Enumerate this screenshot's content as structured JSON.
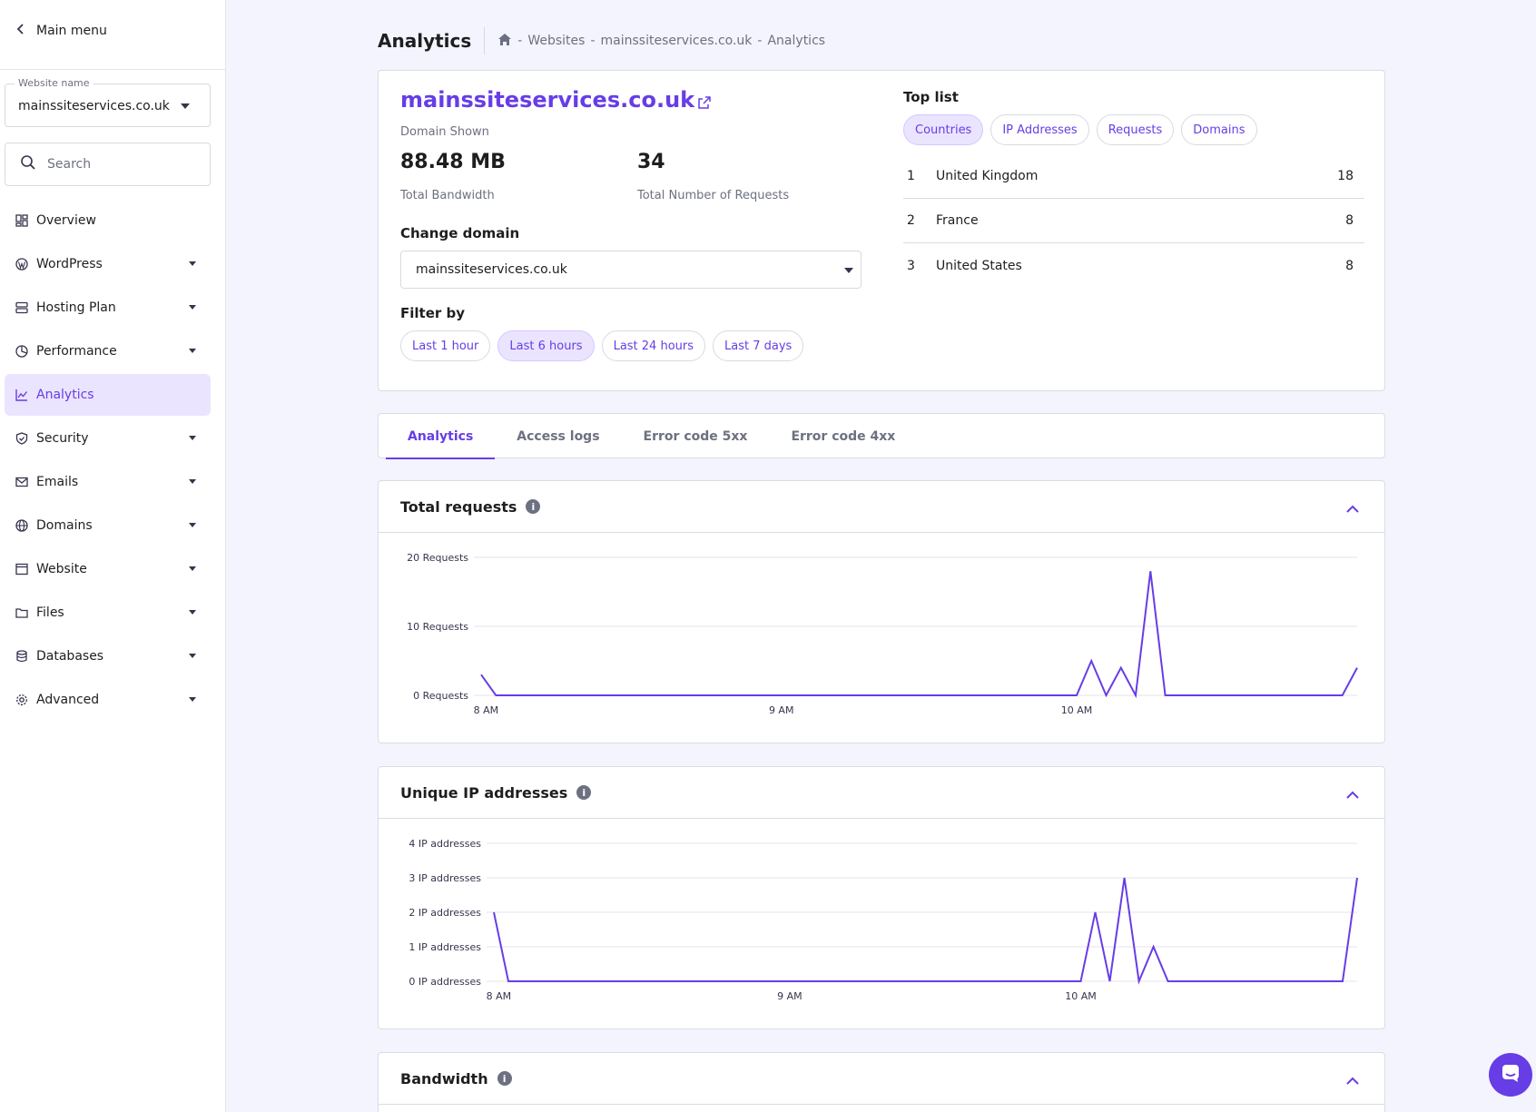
{
  "sidebar": {
    "main_menu_label": "Main menu",
    "website_select": {
      "legend": "Website name",
      "value": "mainssiteservices.co.uk"
    },
    "search_placeholder": "Search",
    "items": [
      {
        "label": "Overview",
        "icon": "grid-icon",
        "has_caret": false,
        "active": false
      },
      {
        "label": "WordPress",
        "icon": "wordpress-icon",
        "has_caret": true,
        "active": false
      },
      {
        "label": "Hosting Plan",
        "icon": "server-icon",
        "has_caret": true,
        "active": false
      },
      {
        "label": "Performance",
        "icon": "pie-chart-icon",
        "has_caret": true,
        "active": false
      },
      {
        "label": "Analytics",
        "icon": "analytics-icon",
        "has_caret": false,
        "active": true
      },
      {
        "label": "Security",
        "icon": "shield-icon",
        "has_caret": true,
        "active": false
      },
      {
        "label": "Emails",
        "icon": "mail-icon",
        "has_caret": true,
        "active": false
      },
      {
        "label": "Domains",
        "icon": "globe-icon",
        "has_caret": true,
        "active": false
      },
      {
        "label": "Website",
        "icon": "browser-icon",
        "has_caret": true,
        "active": false
      },
      {
        "label": "Files",
        "icon": "folder-icon",
        "has_caret": true,
        "active": false
      },
      {
        "label": "Databases",
        "icon": "database-icon",
        "has_caret": true,
        "active": false
      },
      {
        "label": "Advanced",
        "icon": "gear-icon",
        "has_caret": true,
        "active": false
      }
    ]
  },
  "header": {
    "title": "Analytics",
    "breadcrumb": [
      "-",
      "Websites",
      "-",
      "mainssiteservices.co.uk",
      "-",
      "Analytics"
    ]
  },
  "summary": {
    "domain": "mainssiteservices.co.uk",
    "domain_caption": "Domain Shown",
    "bandwidth_value": "88.48 MB",
    "bandwidth_label": "Total Bandwidth",
    "requests_value": "34",
    "requests_label": "Total Number of Requests",
    "change_domain_label": "Change domain",
    "change_domain_value": "mainssiteservices.co.uk",
    "filter_label": "Filter by",
    "filters": [
      {
        "label": "Last 1 hour",
        "selected": false
      },
      {
        "label": "Last 6 hours",
        "selected": true
      },
      {
        "label": "Last 24 hours",
        "selected": false
      },
      {
        "label": "Last 7 days",
        "selected": false
      }
    ]
  },
  "top_list": {
    "title": "Top list",
    "tabs": [
      {
        "label": "Countries",
        "selected": true
      },
      {
        "label": "IP Addresses",
        "selected": false
      },
      {
        "label": "Requests",
        "selected": false
      },
      {
        "label": "Domains",
        "selected": false
      }
    ],
    "rows": [
      {
        "rank": "1",
        "name": "United Kingdom",
        "count": "18"
      },
      {
        "rank": "2",
        "name": "France",
        "count": "8"
      },
      {
        "rank": "3",
        "name": "United States",
        "count": "8"
      }
    ]
  },
  "tabs": [
    {
      "label": "Analytics",
      "active": true
    },
    {
      "label": "Access logs",
      "active": false
    },
    {
      "label": "Error code 5xx",
      "active": false
    },
    {
      "label": "Error code 4xx",
      "active": false
    }
  ],
  "panels": {
    "requests_title": "Total requests",
    "ips_title": "Unique IP addresses",
    "bandwidth_title": "Bandwidth"
  },
  "chart_data": [
    {
      "type": "line",
      "title": "Total requests",
      "ylim": [
        0,
        20
      ],
      "yticks": [
        "0 Requests",
        "10 Requests",
        "20 Requests"
      ],
      "ytick_values": [
        0,
        10,
        20
      ],
      "xlim": [
        "07:59",
        "10:57"
      ],
      "xticks": [
        {
          "label": "8 AM",
          "value": "08:00"
        },
        {
          "label": "9 AM",
          "value": "09:00"
        },
        {
          "label": "10 AM",
          "value": "10:00"
        }
      ],
      "color": "#673de6",
      "series": [
        {
          "x": [
            "07:59",
            "08:02",
            "10:00",
            "10:03",
            "10:06",
            "10:09",
            "10:12",
            "10:15",
            "10:18",
            "10:21",
            "10:24",
            "10:27",
            "10:30",
            "10:33",
            "10:36",
            "10:39",
            "10:42",
            "10:45",
            "10:48",
            "10:51",
            "10:54",
            "10:57"
          ],
          "values": [
            3,
            0,
            0,
            5,
            0,
            4,
            0,
            18,
            0,
            0,
            0,
            0,
            0,
            0,
            0,
            0,
            0,
            0,
            0,
            0,
            0,
            4
          ]
        }
      ]
    },
    {
      "type": "line",
      "title": "Unique IP addresses",
      "ylim": [
        0,
        4
      ],
      "yticks": [
        "0 IP addresses",
        "1 IP addresses",
        "2 IP addresses",
        "3 IP addresses",
        "4 IP addresses"
      ],
      "ytick_values": [
        0,
        1,
        2,
        3,
        4
      ],
      "xlim": [
        "07:59",
        "10:57"
      ],
      "xticks": [
        {
          "label": "8 AM",
          "value": "08:00"
        },
        {
          "label": "9 AM",
          "value": "09:00"
        },
        {
          "label": "10 AM",
          "value": "10:00"
        }
      ],
      "color": "#673de6",
      "series": [
        {
          "x": [
            "07:59",
            "08:02",
            "10:00",
            "10:03",
            "10:06",
            "10:09",
            "10:12",
            "10:15",
            "10:18",
            "10:21",
            "10:24",
            "10:27",
            "10:30",
            "10:33",
            "10:36",
            "10:39",
            "10:42",
            "10:45",
            "10:48",
            "10:51",
            "10:54",
            "10:57"
          ],
          "values": [
            2,
            0,
            0,
            2,
            0,
            3,
            0,
            1,
            0,
            0,
            0,
            0,
            0,
            0,
            0,
            0,
            0,
            0,
            0,
            0,
            0,
            3
          ]
        }
      ]
    }
  ],
  "colors": {
    "accent": "#673de6",
    "accent_light": "#ebe4ff"
  }
}
